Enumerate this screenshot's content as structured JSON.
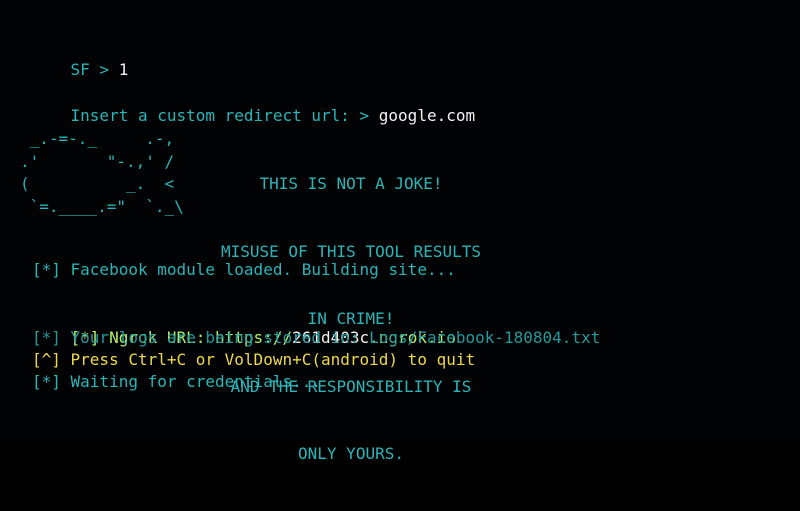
{
  "terminal": {
    "prompt_line": {
      "prompt": "SF > ",
      "input": "1"
    },
    "redirect_line": {
      "prompt": "Insert a custom redirect url: > ",
      "input": "google.com"
    },
    "ascii_art": " _.-=-._     .-,\n.'       \"-.,' /\n(          _.  <\n `=.____.=\"  `._\\",
    "warning": [
      "THIS IS NOT A JOKE!",
      "MISUSE OF THIS TOOL RESULTS",
      "IN CRIME!",
      "AND THE RESPONSIBILITY IS",
      "ONLY YOURS."
    ],
    "module_loaded": "[*] Facebook module loaded. Building site...",
    "ngrok_line": {
      "prefix": "[*] Ngrok URL: https://",
      "host": "261d403c",
      "suffix": ".ngrok.io"
    },
    "logs_line": "[*] Your logs are being stored in: Logs/Facebook-180804.txt",
    "quit_line": "[^] Press Ctrl+C or VolDown+C(android) to quit",
    "waiting_line": "[*] Waiting for credentials..."
  },
  "colors": {
    "background": "#010203",
    "cyan": "#2ab5b8",
    "white": "#f2f2f2",
    "green": "#8be04a",
    "yellow": "#f0d84a"
  }
}
